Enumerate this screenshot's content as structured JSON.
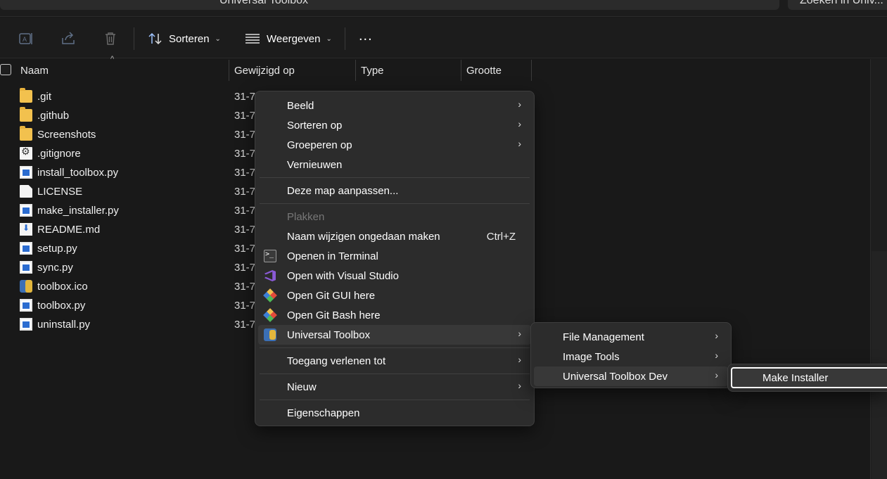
{
  "top": {
    "address_text": "Universal Toolbox",
    "search_text": "Zoeken in Univ..."
  },
  "toolbar": {
    "rename_icon": "rename-icon",
    "share_icon": "share-icon",
    "delete_icon": "trash-icon",
    "sort_label": "Sorteren",
    "view_label": "Weergeven",
    "more_label": "..."
  },
  "columns": {
    "name": "Naam",
    "modified": "Gewijzigd op",
    "type": "Type",
    "size": "Grootte"
  },
  "files": [
    {
      "name": ".git",
      "date": "31-7",
      "icon": "folder-icon"
    },
    {
      "name": ".github",
      "date": "31-7",
      "icon": "folder-icon"
    },
    {
      "name": "Screenshots",
      "date": "31-7",
      "icon": "folder-icon"
    },
    {
      "name": ".gitignore",
      "date": "31-7",
      "icon": "settings-file-icon"
    },
    {
      "name": "install_toolbox.py",
      "date": "31-7",
      "icon": "python-file-icon"
    },
    {
      "name": "LICENSE",
      "date": "31-7",
      "icon": "file-icon"
    },
    {
      "name": "make_installer.py",
      "date": "31-7",
      "icon": "python-file-icon"
    },
    {
      "name": "README.md",
      "date": "31-7",
      "icon": "markdown-file-icon"
    },
    {
      "name": "setup.py",
      "date": "31-7",
      "icon": "python-file-icon"
    },
    {
      "name": "sync.py",
      "date": "31-7",
      "icon": "python-file-icon"
    },
    {
      "name": "toolbox.ico",
      "date": "31-7",
      "icon": "ico-file-icon"
    },
    {
      "name": "toolbox.py",
      "date": "31-7",
      "icon": "python-file-icon"
    },
    {
      "name": "uninstall.py",
      "date": "31-7",
      "icon": "python-file-icon"
    }
  ],
  "context_menu": {
    "items": [
      {
        "label": "Beeld"
      },
      {
        "label": "Sorteren op"
      },
      {
        "label": "Groeperen op"
      },
      {
        "label": "Vernieuwen"
      },
      {
        "label": "Deze map aanpassen..."
      },
      {
        "label": "Plakken"
      },
      {
        "label": "Naam wijzigen ongedaan maken",
        "shortcut": "Ctrl+Z"
      },
      {
        "label": "Openen in Terminal",
        "icon": "terminal-icon"
      },
      {
        "label": "Open with Visual Studio",
        "icon": "visual-studio-icon"
      },
      {
        "label": "Open Git GUI here",
        "icon": "git-icon"
      },
      {
        "label": "Open Git Bash here",
        "icon": "git-icon"
      },
      {
        "label": "Universal Toolbox",
        "icon": "universal-toolbox-icon"
      },
      {
        "label": "Toegang verlenen tot"
      },
      {
        "label": "Nieuw"
      },
      {
        "label": "Eigenschappen"
      }
    ],
    "submenu_arrow": "›"
  },
  "submenu": {
    "items": [
      {
        "label": "File Management"
      },
      {
        "label": "Image Tools"
      },
      {
        "label": "Universal Toolbox Dev"
      }
    ]
  },
  "submenu2": {
    "items": [
      {
        "label": "Make Installer"
      }
    ]
  },
  "colors": {
    "background": "#191919",
    "menu_bg": "#2c2c2c",
    "highlight": "#383838",
    "focus_border": "#ffffff"
  }
}
